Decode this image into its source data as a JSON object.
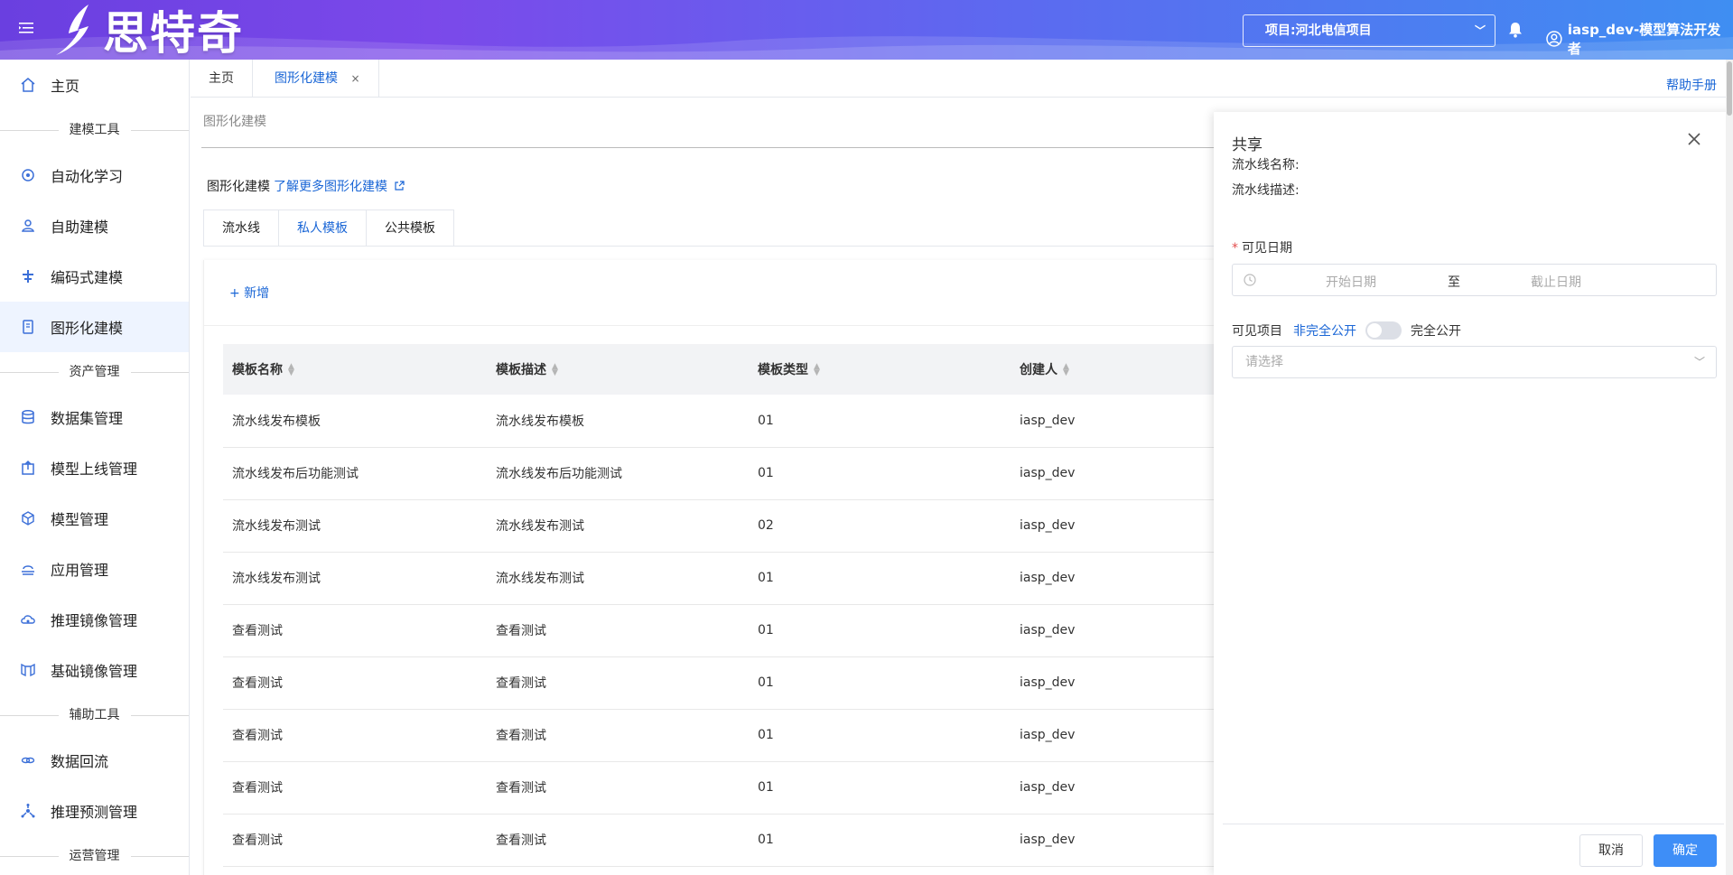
{
  "header": {
    "logo_text": "思特奇",
    "project_label": "项目:河北电信项目",
    "user_label": "iasp_dev-模型算法开发者"
  },
  "sidebar": {
    "items": [
      {
        "type": "item",
        "label": "主页",
        "icon": "home-icon"
      },
      {
        "type": "group",
        "label": "建模工具"
      },
      {
        "type": "item",
        "label": "自动化学习",
        "icon": "automl-icon"
      },
      {
        "type": "item",
        "label": "自助建模",
        "icon": "self-modeling-icon"
      },
      {
        "type": "item",
        "label": "编码式建模",
        "icon": "code-modeling-icon"
      },
      {
        "type": "item",
        "label": "图形化建模",
        "icon": "graphic-modeling-icon",
        "active": true
      },
      {
        "type": "group",
        "label": "资产管理"
      },
      {
        "type": "item",
        "label": "数据集管理",
        "icon": "dataset-icon"
      },
      {
        "type": "item",
        "label": "模型上线管理",
        "icon": "model-deploy-icon"
      },
      {
        "type": "item",
        "label": "模型管理",
        "icon": "model-icon"
      },
      {
        "type": "item",
        "label": "应用管理",
        "icon": "app-icon"
      },
      {
        "type": "item",
        "label": "推理镜像管理",
        "icon": "inference-image-icon"
      },
      {
        "type": "item",
        "label": "基础镜像管理",
        "icon": "base-image-icon"
      },
      {
        "type": "group",
        "label": "辅助工具"
      },
      {
        "type": "item",
        "label": "数据回流",
        "icon": "data-backflow-icon"
      },
      {
        "type": "item",
        "label": "推理预测管理",
        "icon": "inference-predict-icon"
      },
      {
        "type": "group",
        "label": "运营管理"
      }
    ]
  },
  "tabs": {
    "home": "主页",
    "current": "图形化建模",
    "close": "×",
    "help": "帮助手册"
  },
  "main": {
    "breadcrumb": "图形化建模",
    "intro_text": "图形化建模",
    "intro_link": "了解更多图形化建模",
    "subtabs": [
      "流水线",
      "私人模板",
      "公共模板"
    ],
    "add_label": "+ 新增",
    "table": {
      "columns": [
        "模板名称",
        "模板描述",
        "模板类型",
        "创建人"
      ],
      "rows": [
        [
          "流水线发布模板",
          "流水线发布模板",
          "01",
          "iasp_dev"
        ],
        [
          "流水线发布后功能测试",
          "流水线发布后功能测试",
          "01",
          "iasp_dev"
        ],
        [
          "流水线发布测试",
          "流水线发布测试",
          "02",
          "iasp_dev"
        ],
        [
          "流水线发布测试",
          "流水线发布测试",
          "01",
          "iasp_dev"
        ],
        [
          "查看测试",
          "查看测试",
          "01",
          "iasp_dev"
        ],
        [
          "查看测试",
          "查看测试",
          "01",
          "iasp_dev"
        ],
        [
          "查看测试",
          "查看测试",
          "01",
          "iasp_dev"
        ],
        [
          "查看测试",
          "查看测试",
          "01",
          "iasp_dev"
        ],
        [
          "查看测试",
          "查看测试",
          "01",
          "iasp_dev"
        ]
      ]
    }
  },
  "drawer": {
    "title": "共享",
    "pipeline_name_label": "流水线名称:",
    "pipeline_desc_label": "流水线描述:",
    "required_mark": "*",
    "visible_date_label": "可见日期",
    "start_placeholder": "开始日期",
    "range_separator": "至",
    "end_placeholder": "截止日期",
    "visible_project_label": "可见项目",
    "option_partial": "非完全公开",
    "option_full": "完全公开",
    "select_placeholder": "请选择",
    "cancel_label": "取消",
    "ok_label": "确定"
  },
  "colors": {
    "accent": "#1a66d6",
    "primary_button": "#3e8ef7",
    "header_start": "#6a3fe0",
    "header_end": "#3f8ef2"
  }
}
